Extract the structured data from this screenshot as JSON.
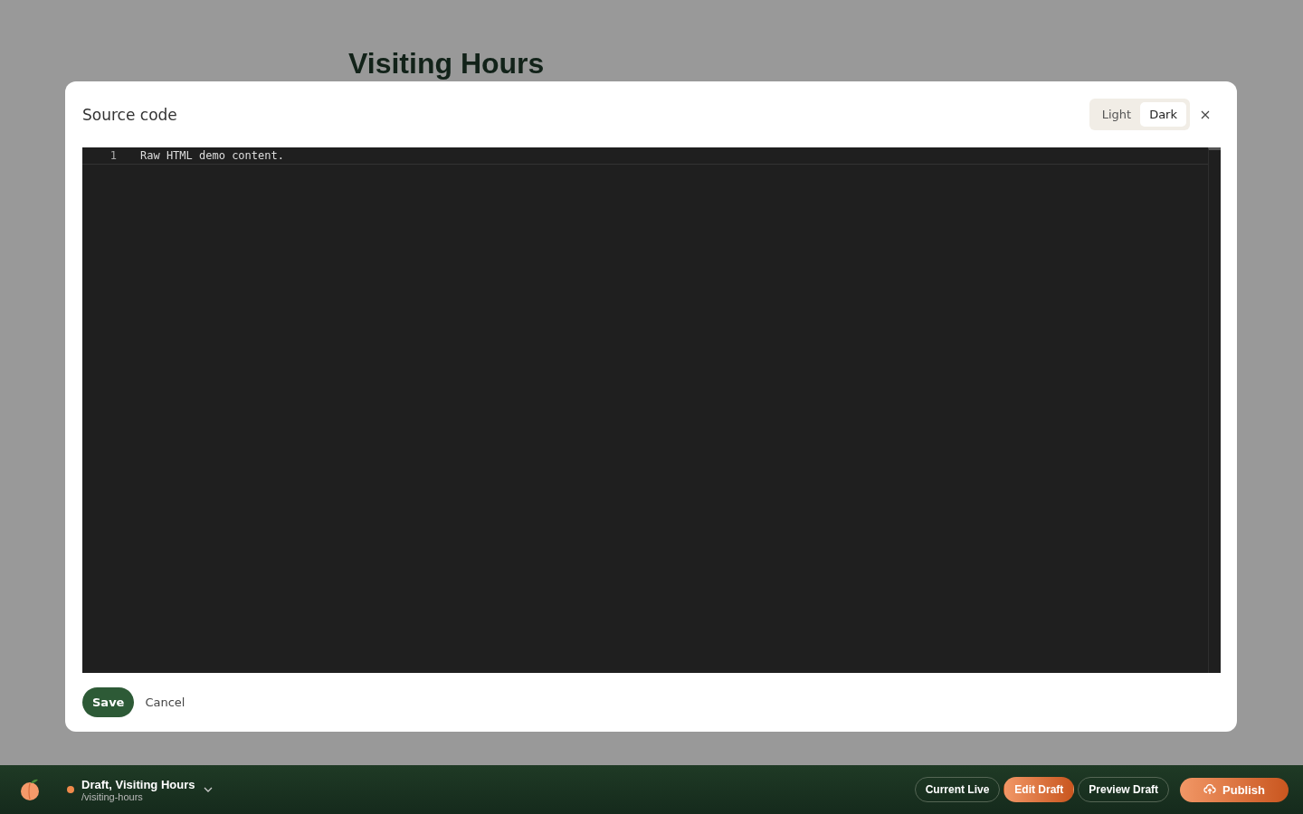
{
  "page": {
    "title": "Visiting Hours"
  },
  "dialog": {
    "title": "Source code",
    "theme_options": [
      {
        "label": "Light",
        "selected": false
      },
      {
        "label": "Dark",
        "selected": true
      }
    ],
    "editor": {
      "lines": [
        {
          "number": "1",
          "text": "Raw HTML demo content."
        }
      ]
    },
    "buttons": {
      "save": "Save",
      "cancel": "Cancel"
    }
  },
  "bottom_bar": {
    "status": {
      "color": "#f08a4b",
      "title": "Draft, Visiting Hours",
      "path": "/visiting-hours"
    },
    "modes": [
      {
        "label": "Current Live",
        "selected": false
      },
      {
        "label": "Edit Draft",
        "selected": true
      },
      {
        "label": "Preview Draft",
        "selected": false
      }
    ],
    "publish": "Publish"
  }
}
